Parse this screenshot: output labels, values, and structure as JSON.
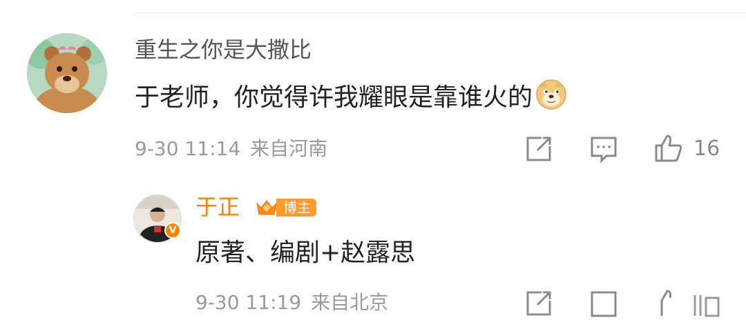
{
  "comment": {
    "username": "重生之你是大撒比",
    "text": "于老师，你觉得许我耀眼是靠谁火的",
    "emoji_icon": "doge-emoji-icon",
    "date": "9-30 11:14",
    "location": "来自河南",
    "like_count": "16"
  },
  "reply": {
    "username": "于正",
    "badge_label": "博主",
    "verified_badge": "V",
    "text": "原著、编剧+赵露思",
    "date": "9-30 11:19",
    "location": "来自北京"
  },
  "colors": {
    "accent": "#ff8200",
    "meta_text": "#9a9a9a",
    "body_text": "#222222"
  }
}
